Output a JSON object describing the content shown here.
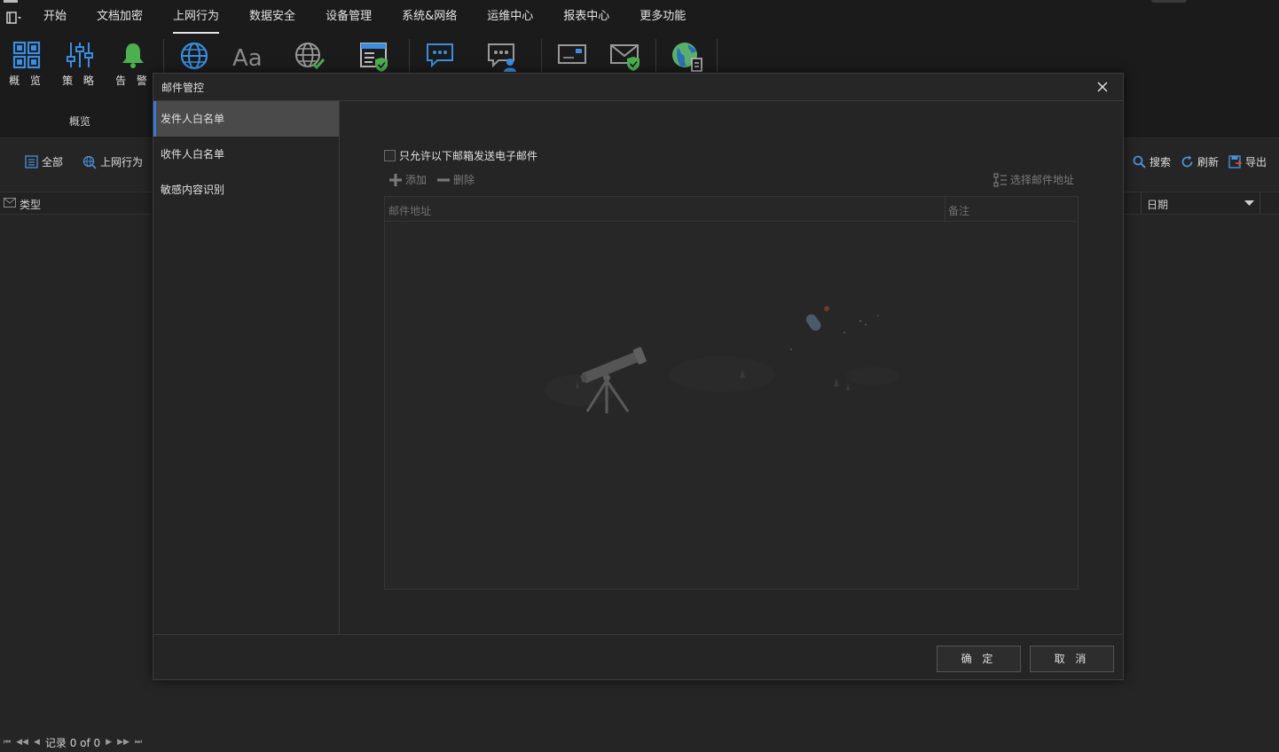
{
  "menubar": {
    "items": [
      {
        "label": "开始"
      },
      {
        "label": "文档加密"
      },
      {
        "label": "上网行为",
        "active": true
      },
      {
        "label": "数据安全"
      },
      {
        "label": "设备管理"
      },
      {
        "label": "系统&网络"
      },
      {
        "label": "运维中心"
      },
      {
        "label": "报表中心"
      },
      {
        "label": "更多功能"
      }
    ]
  },
  "ribbon": {
    "overview": {
      "label": "概 览",
      "icon": "grid-icon"
    },
    "policy": {
      "label": "策 略",
      "icon": "sliders-icon"
    },
    "alert": {
      "label": "告 警",
      "icon": "bell-icon"
    },
    "group_label": "概览",
    "accent_green": "#4caf50",
    "accent_blue": "#3a8de0"
  },
  "toolbar": {
    "all": "全部",
    "web_behavior": "上网行为",
    "search": "搜索",
    "refresh": "刷新",
    "export": "导出"
  },
  "grid": {
    "col_type": "类型",
    "col_date": "日期"
  },
  "status": {
    "records": "记录 0 of 0"
  },
  "dialog": {
    "title": "邮件管控",
    "sidebar": [
      {
        "label": "发件人白名单",
        "selected": true
      },
      {
        "label": "收件人白名单"
      },
      {
        "label": "敏感内容识别"
      }
    ],
    "checkbox_label": "只允许以下邮箱发送电子邮件",
    "add": "添加",
    "delete": "删除",
    "select_address": "选择邮件地址",
    "table": {
      "col_email": "邮件地址",
      "col_note": "备注"
    },
    "ok": "确 定",
    "cancel": "取 消"
  }
}
